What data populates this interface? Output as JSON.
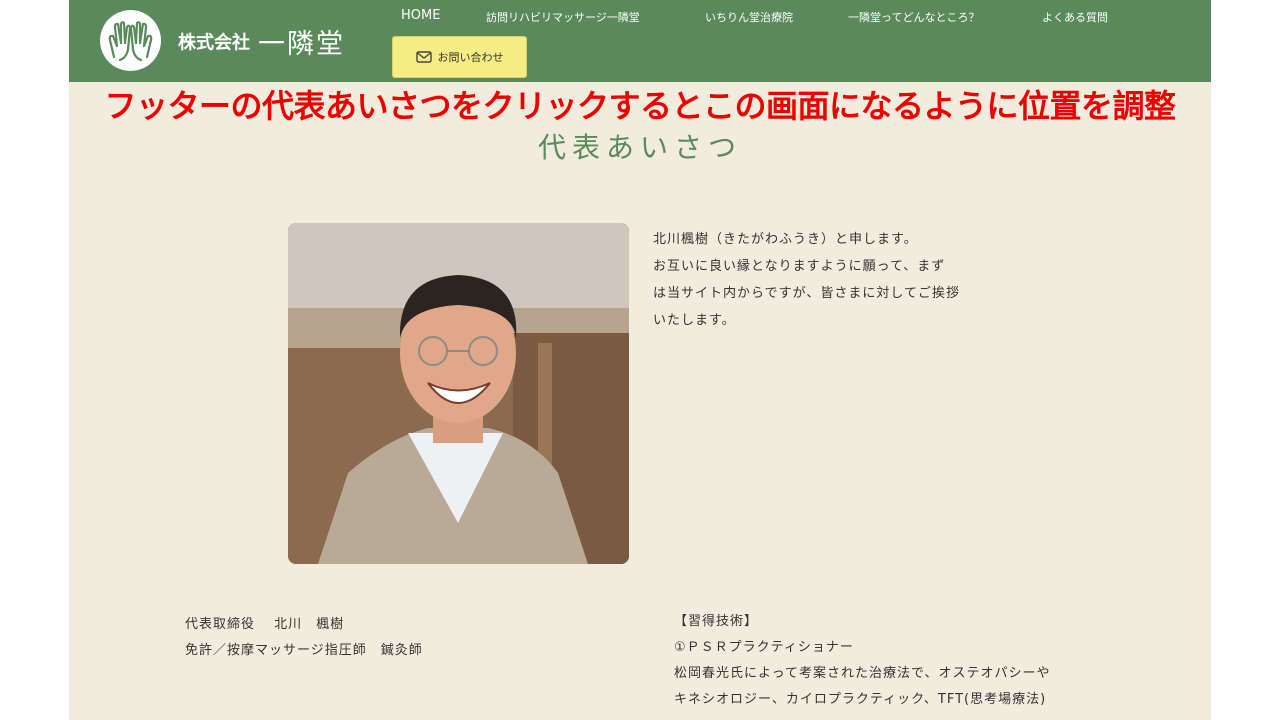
{
  "header": {
    "logo_company_type": "株式会社",
    "logo_name": "一隣堂",
    "nav": [
      {
        "label": "HOME"
      },
      {
        "label": "訪問リハビリマッサージ一隣堂"
      },
      {
        "label": "いちりん堂治療院"
      },
      {
        "label": "一隣堂ってどんなところ？"
      },
      {
        "label": "よくある質問"
      }
    ],
    "contact_label": "お問い合わせ"
  },
  "annotation": "フッターの代表あいさつをクリックするとこの画面になるように位置を調整",
  "section_title": "代表あいさつ",
  "greeting_lines": [
    "北川楓樹（きたがわふうき）と申します。",
    "お互いに良い縁となりますように願って、まず",
    "は当サイト内からですが、皆さまに対してご挨拶",
    "いたします。"
  ],
  "profile": {
    "title_line": "代表取締役　 北川　楓樹",
    "license_line": "免許／按摩マッサージ指圧師　鍼灸師"
  },
  "skills": {
    "heading": "【習得技術】",
    "item1": "①ＰＳＲプラクティショナー",
    "desc1": "松岡春光氏によって考案された治療法で、オステオパシーや",
    "desc2": "キネシオロジー、カイロプラクティック、TFT(思考場療法)"
  },
  "colors": {
    "header_green": "#5a8a5c",
    "page_background": "#f1ecdd",
    "contact_button": "#f5ec83",
    "annotation_red": "#ee0000"
  }
}
